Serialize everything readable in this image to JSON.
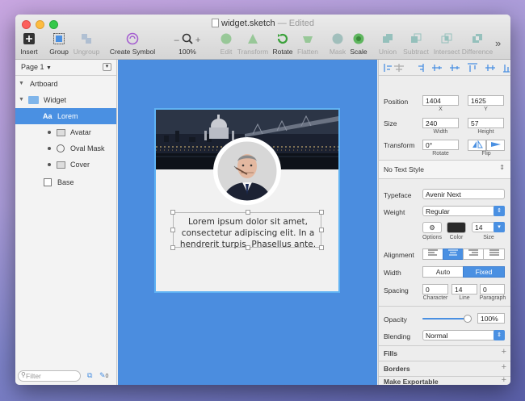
{
  "window": {
    "title": "widget.sketch",
    "status": "— Edited"
  },
  "toolbar": {
    "insert": "Insert",
    "group": "Group",
    "ungroup": "Ungroup",
    "create_symbol": "Create Symbol",
    "zoom": "100%",
    "edit": "Edit",
    "transform": "Transform",
    "rotate": "Rotate",
    "flatten": "Flatten",
    "mask": "Mask",
    "scale": "Scale",
    "union": "Union",
    "subtract": "Subtract",
    "intersect": "Intersect",
    "difference": "Difference",
    "overflow": "»"
  },
  "layers": {
    "page": "Page 1",
    "items": [
      {
        "label": "Artboard"
      },
      {
        "label": "Widget"
      },
      {
        "label": "Lorem"
      },
      {
        "label": "Avatar"
      },
      {
        "label": "Oval Mask"
      },
      {
        "label": "Cover"
      },
      {
        "label": "Base"
      }
    ],
    "filter_placeholder": "Filter",
    "footer_count": "0"
  },
  "canvas": {
    "lorem_text": "Lorem ipsum dolor sit amet, consectetur adipiscing elit. In a hendrerit turpis. Phasellus ante."
  },
  "inspector": {
    "position_label": "Position",
    "x_value": "1404",
    "y_value": "1625",
    "x_cap": "X",
    "y_cap": "Y",
    "size_label": "Size",
    "width_value": "240",
    "height_value": "57",
    "width_cap": "Width",
    "height_cap": "Height",
    "transform_label": "Transform",
    "rotate_value": "0°",
    "rotate_cap": "Rotate",
    "flip_cap": "Flip",
    "text_style": "No Text Style",
    "typeface_label": "Typeface",
    "typeface_value": "Avenir Next",
    "weight_label": "Weight",
    "weight_value": "Regular",
    "options_cap": "Options",
    "color_cap": "Color",
    "size_value": "14",
    "size_cap": "Size",
    "alignment_label": "Alignment",
    "width_label": "Width",
    "auto_label": "Auto",
    "fixed_label": "Fixed",
    "spacing_label": "Spacing",
    "character_value": "0",
    "line_value": "14",
    "paragraph_value": "0",
    "character_cap": "Character",
    "line_cap": "Line",
    "paragraph_cap": "Paragraph",
    "opacity_label": "Opacity",
    "opacity_value": "100%",
    "opacity_level": 1.0,
    "blending_label": "Blending",
    "blending_value": "Normal",
    "fills": "Fills",
    "borders": "Borders",
    "export": "Make Exportable"
  },
  "colors": {
    "accent": "#4a90e2",
    "canvas": "#4b8ddf",
    "selection": "#60b2f3"
  }
}
